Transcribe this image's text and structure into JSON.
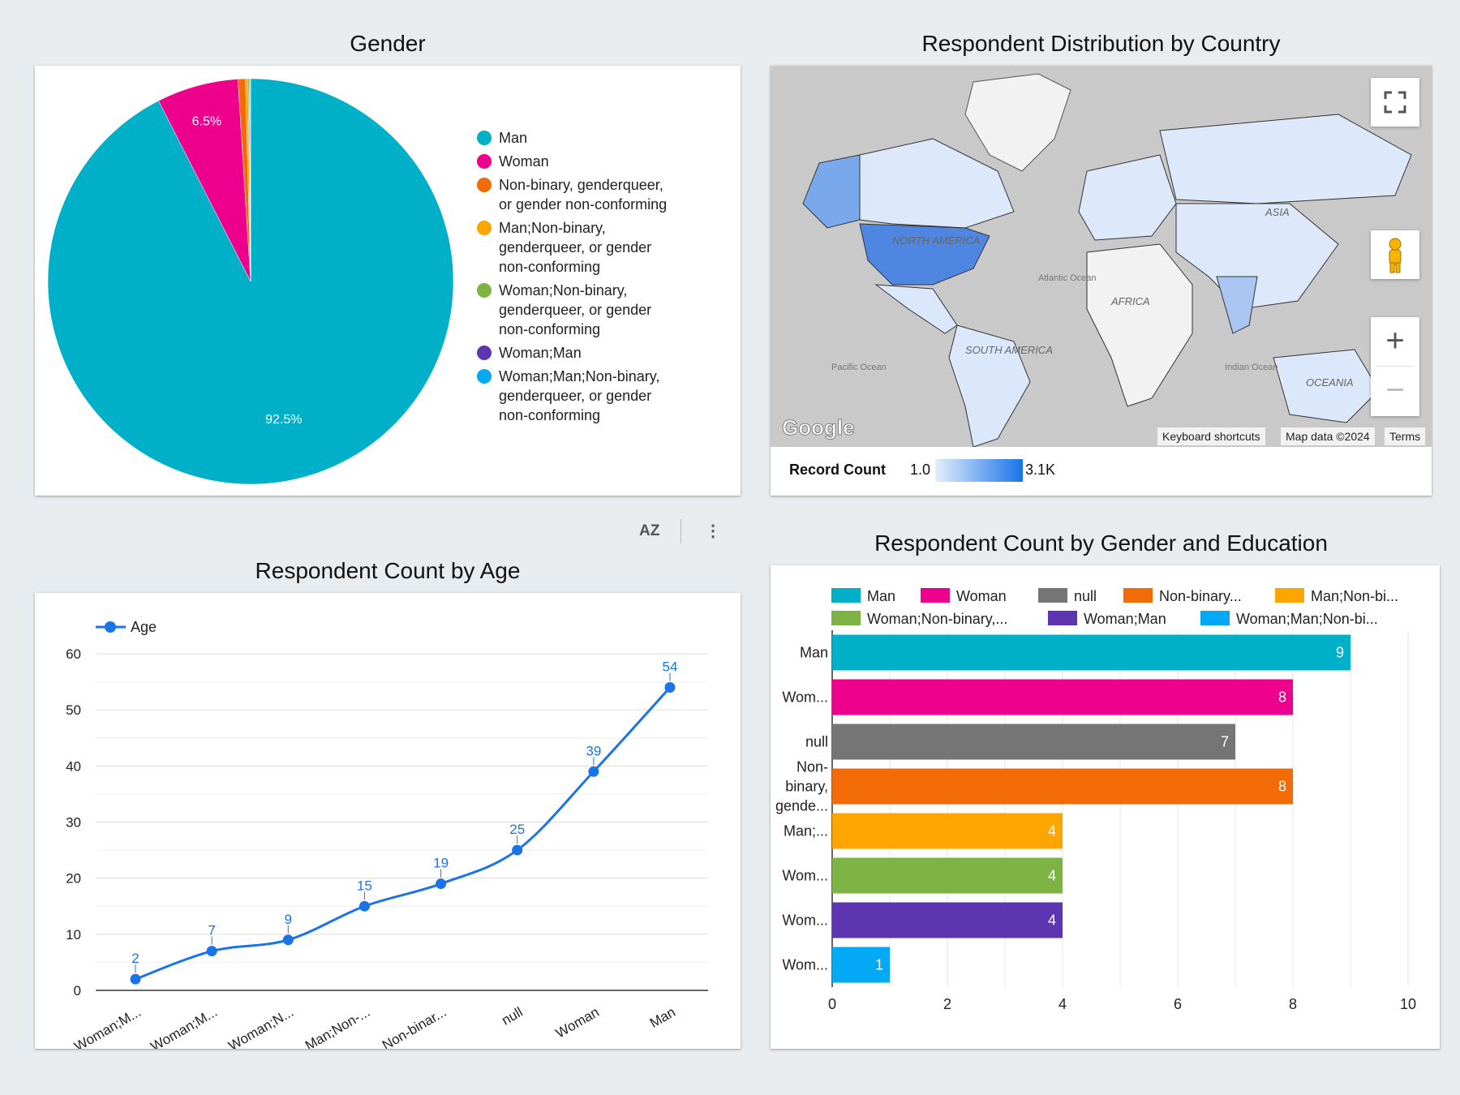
{
  "gender_chart": {
    "title": "Gender",
    "chart_data": {
      "type": "pie",
      "slices": [
        {
          "label": "Man",
          "percent": 92.5,
          "color": "#00b0c8"
        },
        {
          "label": "Woman",
          "percent": 6.5,
          "color": "#ec008c"
        },
        {
          "label": "Non-binary, genderqueer, or gender non-conforming",
          "percent": 0.6,
          "color": "#f26b06"
        },
        {
          "label": "Man;Non-binary, genderqueer, or gender non-conforming",
          "percent": 0.2,
          "color": "#ffa500"
        },
        {
          "label": "Woman;Non-binary, genderqueer, or gender non-conforming",
          "percent": 0.1,
          "color": "#7cb342"
        },
        {
          "label": "Woman;Man",
          "percent": 0.05,
          "color": "#5e35b1"
        },
        {
          "label": "Woman;Man;Non-binary, genderqueer, or gender non-conforming",
          "percent": 0.05,
          "color": "#03a9f4"
        }
      ],
      "data_labels": [
        "92.5%",
        "6.5%"
      ],
      "legend_position": "right"
    },
    "legend": [
      {
        "lines": [
          "Man"
        ],
        "color": "#00b0c8"
      },
      {
        "lines": [
          "Woman"
        ],
        "color": "#ec008c"
      },
      {
        "lines": [
          "Non-binary, genderqueer,",
          "or gender non-conforming"
        ],
        "color": "#f26b06"
      },
      {
        "lines": [
          "Man;Non-binary,",
          "genderqueer, or gender",
          "non-conforming"
        ],
        "color": "#ffa500"
      },
      {
        "lines": [
          "Woman;Non-binary,",
          "genderqueer, or gender",
          "non-conforming"
        ],
        "color": "#7cb342"
      },
      {
        "lines": [
          "Woman;Man"
        ],
        "color": "#5e35b1"
      },
      {
        "lines": [
          "Woman;Man;Non-binary,",
          "genderqueer, or gender",
          "non-conforming"
        ],
        "color": "#03a9f4"
      }
    ]
  },
  "map_chart": {
    "title": "Respondent Distribution by Country",
    "ocean_labels": [
      "NORTH AMERICA",
      "Atlantic Ocean",
      "ASIA",
      "AFRICA",
      "SOUTH AMERICA",
      "Pacific Ocean",
      "Indian Ocean",
      "OCEANIA"
    ],
    "google_logo": "Google",
    "attribution": {
      "shortcuts": "Keyboard shortcuts",
      "map_data": "Map data ©2024",
      "terms": "Terms"
    },
    "zoom_in": "+",
    "zoom_out": "−",
    "colorbar": {
      "label": "Record Count",
      "min": "1.0",
      "max": "3.1K",
      "color_low": "#e3effd",
      "color_high": "#1a73e8"
    }
  },
  "toolbar": {
    "sort_icon": "sort-az-icon",
    "more_icon": "more-vert-icon",
    "sort_glyph": "AZ",
    "more_glyph": "⋮"
  },
  "age_chart": {
    "title": "Respondent Count by Age",
    "chart_data": {
      "type": "line",
      "categories": [
        "Woman;M...",
        "Woman;M...",
        "Woman;N...",
        "Man;Non-...",
        "Non-binar...",
        "null",
        "Woman",
        "Man"
      ],
      "series": [
        {
          "name": "Age",
          "values": [
            2,
            7,
            9,
            15,
            19,
            25,
            39,
            54
          ],
          "color": "#1a73e8"
        }
      ],
      "ylim": [
        0,
        60
      ],
      "yticks": [
        0,
        10,
        20,
        30,
        40,
        50,
        60
      ],
      "grid": true,
      "legend_position": "top-left"
    }
  },
  "edu_chart": {
    "title": "Respondent Count by Gender and Education",
    "chart_data": {
      "type": "bar",
      "orientation": "horizontal",
      "categories": [
        "Man",
        "Wom...",
        "null",
        "Non-binary, gende...",
        "Man;...",
        "Wom...",
        "Wom...",
        "Wom..."
      ],
      "category_lines": [
        [
          "Man"
        ],
        [
          "Wom..."
        ],
        [
          "null"
        ],
        [
          "Non-",
          "binary,",
          "gende..."
        ],
        [
          "Man;..."
        ],
        [
          "Wom..."
        ],
        [
          "Wom..."
        ],
        [
          "Wom..."
        ]
      ],
      "values": [
        9,
        8,
        7,
        8,
        4,
        4,
        4,
        1
      ],
      "colors": [
        "#00b0c8",
        "#ec008c",
        "#757575",
        "#f26b06",
        "#ffa500",
        "#7cb342",
        "#5e35b1",
        "#03a9f4"
      ],
      "xlim": [
        0,
        10
      ],
      "xticks": [
        0,
        2,
        4,
        6,
        8,
        10
      ],
      "grid": true,
      "legend_position": "top"
    },
    "legend": [
      {
        "label": "Man",
        "color": "#00b0c8"
      },
      {
        "label": "Woman",
        "color": "#ec008c"
      },
      {
        "label": "null",
        "color": "#757575"
      },
      {
        "label": "Non-binary...",
        "color": "#f26b06"
      },
      {
        "label": "Man;Non-bi...",
        "color": "#ffa500"
      },
      {
        "label": "Woman;Non-binary,...",
        "color": "#7cb342"
      },
      {
        "label": "Woman;Man",
        "color": "#5e35b1"
      },
      {
        "label": "Woman;Man;Non-bi...",
        "color": "#03a9f4"
      }
    ]
  }
}
